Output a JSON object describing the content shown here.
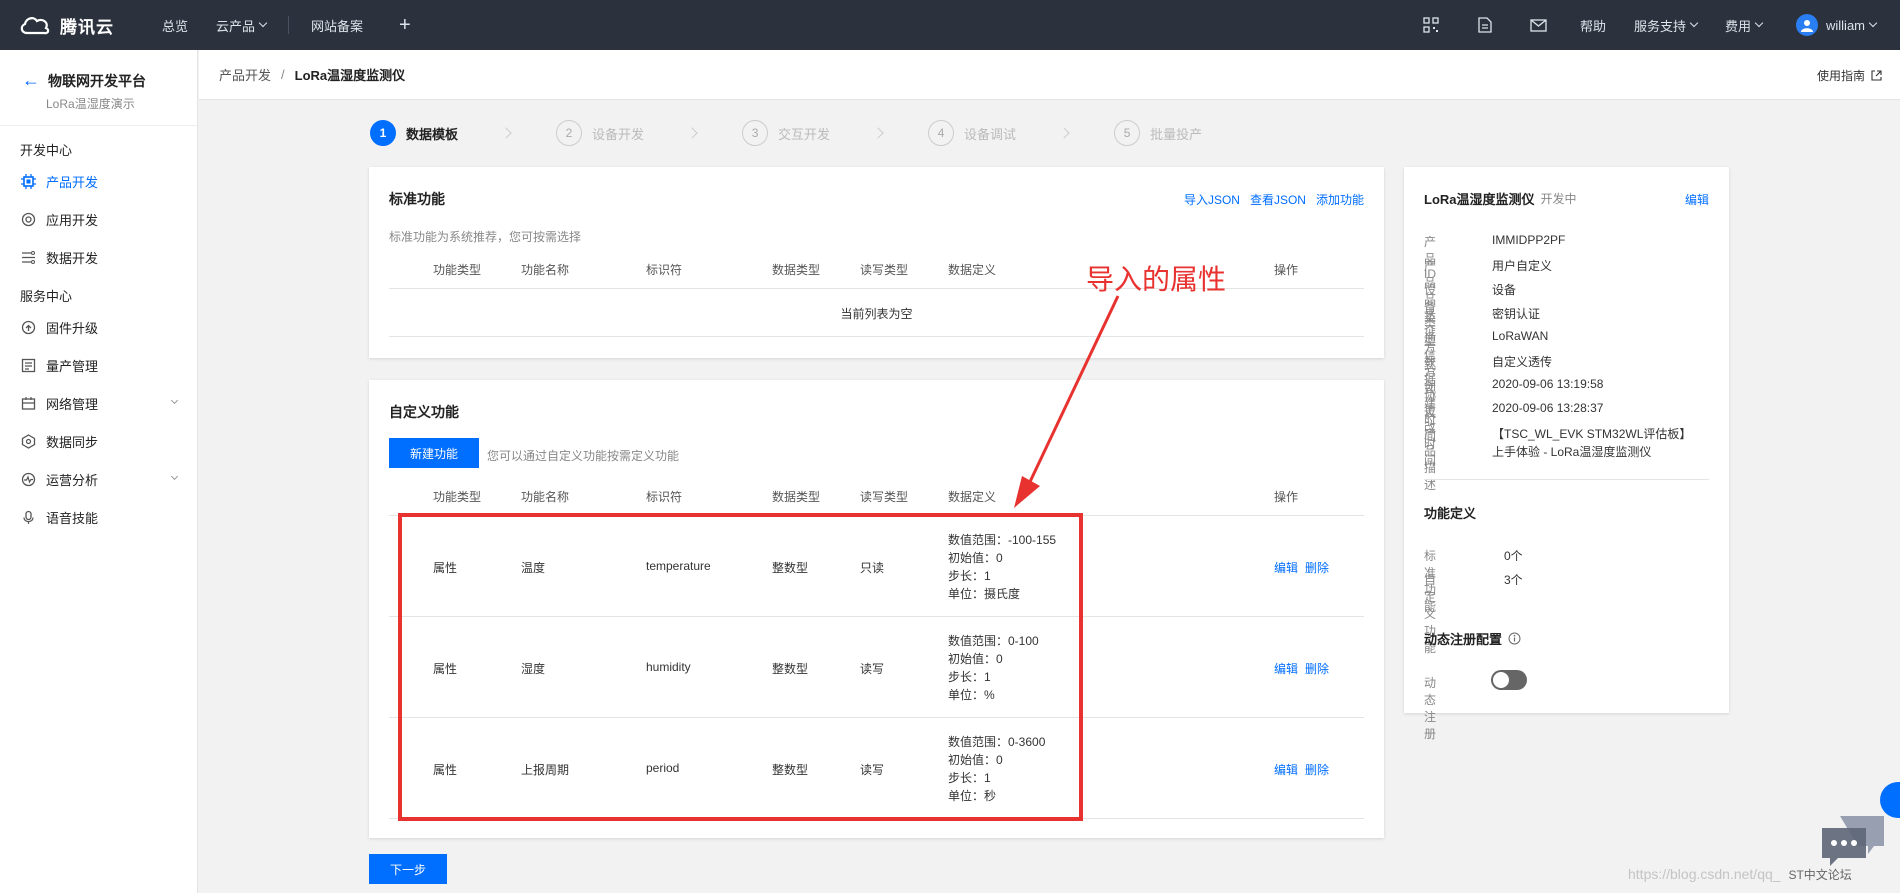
{
  "topbar": {
    "brand": "腾讯云",
    "nav": [
      {
        "label": "总览"
      },
      {
        "label": "云产品"
      },
      {
        "label": "网站备案"
      }
    ],
    "right": {
      "help": "帮助",
      "support": "服务支持",
      "billing": "费用",
      "user": "william"
    }
  },
  "sidebar": {
    "title": "物联网开发平台",
    "subtitle": "LoRa温湿度演示",
    "group1": "开发中心",
    "dev_items": [
      {
        "label": "产品开发",
        "icon": "chip-icon"
      },
      {
        "label": "应用开发",
        "icon": "app-icon"
      },
      {
        "label": "数据开发",
        "icon": "data-flow-icon"
      }
    ],
    "group2": "服务中心",
    "svc_items": [
      {
        "label": "固件升级",
        "icon": "firmware-icon"
      },
      {
        "label": "量产管理",
        "icon": "production-icon"
      },
      {
        "label": "网络管理",
        "icon": "network-icon"
      },
      {
        "label": "数据同步",
        "icon": "sync-icon"
      },
      {
        "label": "运营分析",
        "icon": "analytics-icon"
      },
      {
        "label": "语音技能",
        "icon": "voice-icon"
      }
    ]
  },
  "breadcrumb": {
    "parent": "产品开发",
    "sep": "/",
    "current": "LoRa温湿度监测仪",
    "guide": "使用指南"
  },
  "steps": [
    {
      "n": "1",
      "label": "数据模板"
    },
    {
      "n": "2",
      "label": "设备开发"
    },
    {
      "n": "3",
      "label": "交互开发"
    },
    {
      "n": "4",
      "label": "设备调试"
    },
    {
      "n": "5",
      "label": "批量投产"
    }
  ],
  "standard": {
    "title": "标准功能",
    "desc": "标准功能为系统推荐，您可按需选择",
    "import_json": "导入JSON",
    "view_json": "查看JSON",
    "add": "添加功能",
    "empty": "当前列表为空"
  },
  "columns": {
    "type": "功能类型",
    "name": "功能名称",
    "id": "标识符",
    "dtype": "数据类型",
    "rw": "读写类型",
    "def": "数据定义",
    "op": "操作"
  },
  "custom": {
    "title": "自定义功能",
    "new_btn": "新建功能",
    "hint": "您可以通过自定义功能按需定义功能",
    "edit": "编辑",
    "delete": "删除",
    "rows": [
      {
        "type": "属性",
        "name": "温度",
        "id": "temperature",
        "dtype": "整数型",
        "rw": "只读",
        "d1": "数值范围：-100-155",
        "d2": "初始值：0",
        "d3": "步长：1",
        "d4": "单位：摄氏度"
      },
      {
        "type": "属性",
        "name": "湿度",
        "id": "humidity",
        "dtype": "整数型",
        "rw": "读写",
        "d1": "数值范围：0-100",
        "d2": "初始值：0",
        "d3": "步长：1",
        "d4": "单位：%"
      },
      {
        "type": "属性",
        "name": "上报周期",
        "id": "period",
        "dtype": "整数型",
        "rw": "读写",
        "d1": "数值范围：0-3600",
        "d2": "初始值：0",
        "d3": "步长：1",
        "d4": "单位：秒"
      }
    ]
  },
  "annotation": {
    "text": "导入的属性",
    "color": "#e8322f"
  },
  "next_btn": "下一步",
  "product": {
    "name": "LoRa温湿度监测仪",
    "status": "开发中",
    "edit": "编辑",
    "info": [
      {
        "k": "产品ID",
        "v": "IMMIDPP2PF"
      },
      {
        "k": "产品品类",
        "v": "用户自定义"
      },
      {
        "k": "设备类型",
        "v": "设备"
      },
      {
        "k": "认证方式",
        "v": "密钥认证"
      },
      {
        "k": "通信方式",
        "v": "LoRaWAN"
      },
      {
        "k": "数据协议",
        "v": "自定义透传"
      },
      {
        "k": "创建时间",
        "v": "2020-09-06 13:19:58"
      },
      {
        "k": "更改时间",
        "v": "2020-09-06 13:28:37"
      },
      {
        "k": "产品描述",
        "v": "【TSC_WL_EVK STM32WL评估板】",
        "v2": "上手体验 - LoRa温湿度监测仪"
      }
    ],
    "func_title": "功能定义",
    "func_std_k": "标准功能",
    "func_std_v": "0个",
    "func_cus_k": "自定义功能",
    "func_cus_v": "3个",
    "dyn_title": "动态注册配置",
    "dyn_label": "动态注册"
  },
  "watermark": "https://blog.csdn.net/qq_",
  "watermark2": "ST中文论坛",
  "colors": {
    "accent": "#006eff",
    "topbar": "#2b323e",
    "highlight": "#e8322f"
  }
}
